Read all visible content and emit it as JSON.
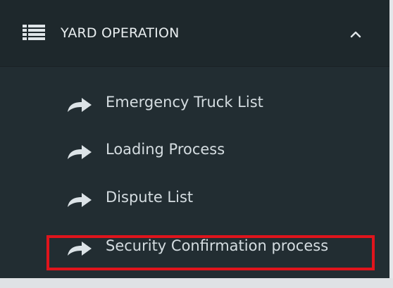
{
  "section": {
    "title": "YARD OPERATION",
    "icon": "list-icon",
    "toggle_icon": "chevron-up-icon",
    "expanded": true
  },
  "menu": {
    "items": [
      {
        "label": "Emergency Truck List",
        "icon": "share-arrow-icon"
      },
      {
        "label": "Loading Process",
        "icon": "share-arrow-icon"
      },
      {
        "label": "Dispute List",
        "icon": "share-arrow-icon"
      },
      {
        "label": "Security Confirmation process",
        "icon": "share-arrow-icon",
        "highlighted": true
      }
    ]
  },
  "colors": {
    "panel_bg": "#222d32",
    "header_bg": "#1e282c",
    "text": "#d5dde1",
    "highlight_border": "#e0141c"
  }
}
